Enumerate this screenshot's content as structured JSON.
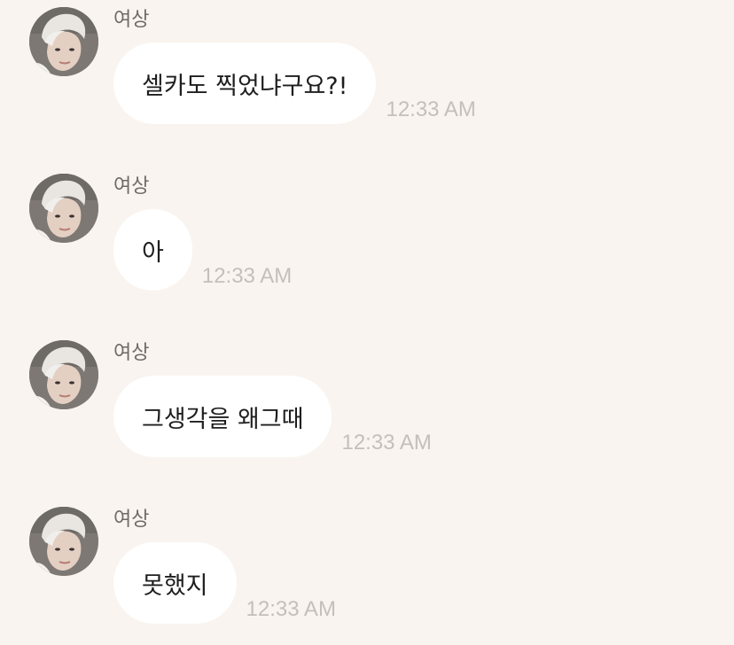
{
  "messages": [
    {
      "sender": "여상",
      "avatar_icon": "profile-photo-avatar",
      "text": "셀카도 찍었냐구요?!",
      "time": "12:33 AM"
    },
    {
      "sender": "여상",
      "avatar_icon": "profile-photo-avatar",
      "text": "아",
      "time": "12:33 AM"
    },
    {
      "sender": "여상",
      "avatar_icon": "profile-photo-avatar",
      "text": "그생각을 왜그때",
      "time": "12:33 AM"
    },
    {
      "sender": "여상",
      "avatar_icon": "profile-photo-avatar",
      "text": "못했지",
      "time": "12:33 AM"
    }
  ],
  "colors": {
    "background": "#f9f4ef",
    "bubble": "#ffffff",
    "sender_name": "#6f6a67",
    "timestamp": "#c4bfbb",
    "message_text": "#1e1e1e"
  }
}
